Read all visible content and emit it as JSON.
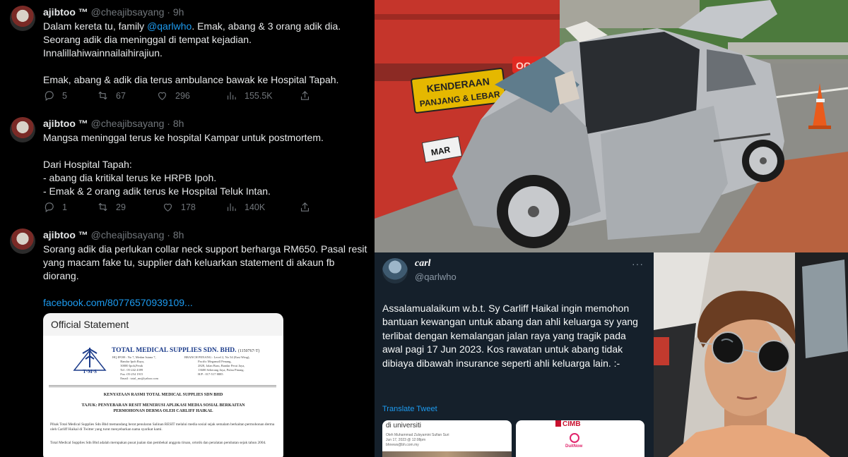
{
  "thread": {
    "tweets": [
      {
        "name": "ajibtoo ™",
        "handle": "@cheajibsayang",
        "time": "· 9h",
        "lines": {
          "l1a": "Dalam kereta tu, family ",
          "l1m": "@qarlwho",
          "l1b": ". Emak, abang & 3 orang adik dia.",
          "l2": "Seorang adik dia meninggal di tempat kejadian.",
          "l3": "Innalillahiwainnailaihirajiun.",
          "l4": "Emak, abang & adik dia terus ambulance bawak ke Hospital Tapah."
        },
        "replies": "5",
        "retweets": "67",
        "likes": "296",
        "views": "155.5K"
      },
      {
        "name": "ajibtoo ™",
        "handle": "@cheajibsayang",
        "time": "· 8h",
        "lines": {
          "l1": "Mangsa meninggal terus ke hospital Kampar untuk postmortem.",
          "l2": "Dari Hospital Tapah:",
          "l3": "- abang dia kritikal terus ke HRPB Ipoh.",
          "l4": "- Emak & 2 orang adik terus ke Hospital Teluk Intan."
        },
        "replies": "1",
        "retweets": "29",
        "likes": "178",
        "views": "140K"
      },
      {
        "name": "ajibtoo ™",
        "handle": "@cheajibsayang",
        "time": "· 8h",
        "lines": {
          "l1": "Sorang adik dia perlukan collar neck support berharga RM650. Pasal resit",
          "l2": "yang macam fake tu, supplier dah keluarkan statement di akaun fb",
          "l3": "diorang.",
          "link": "facebook.com/80776570939109..."
        }
      }
    ],
    "statement": {
      "title": "Official Statement",
      "company": "TOTAL MEDICAL SUPPLIES SDN. BHD.",
      "company_no": "(1150767-T)",
      "hq": "HQ IPOH : No 7, Medan Istana 7,\n          Bandar Ipoh Raya,\n          30000 Ipoh,Perak\n          Tel : 05-242 4399\n          Fax :05-254 1915\n          Email : total_ms@yahoo.com",
      "branch": "BRANCH PENANG : Level 2, No 54 (East Wing),\n                 Pacific Megamall Penang,\n                 2828, Jalan Baru, Bandar Perai Jaya,\n                 13600 Seberang Jaya, Pulau Pinang.\n                 H/P : 017-517 8885",
      "logo_text": "T·M·S",
      "heading1": "KENYATAAN RASMI TOTAL MEDICAL SUPPLIES SDN BHD",
      "heading2": "TAJUK: PENYEBARAN RESIT MENERUSI APLIKASI MEDIA SOSIAL BERKAITAN",
      "heading3": "PERMOHONAN DERMA OLEH CARLIFF HAIKAL",
      "para1": "Pihak Total Medical Supplies Sdn Bhd memandang berat penularan Salinan RESIT melalui media sosial sejak semalam berkaitan permohonan derma oleh Carliff Haikal di Twitter yang turut menyebarkan nama syarikat kami.",
      "para2": "Total Medical Supplies Sdn Bhd adalah merupakan pusat jualan dan pembekal anggota tiruan, ortotik dan peralatan perubatan sejak tahun 2004."
    }
  },
  "photo": {
    "sign_line1": "KENDERAAN",
    "sign_line2": "PANJANG & LEBAR",
    "plate": "MAR",
    "light_text": "OCO"
  },
  "carl": {
    "name": "carl",
    "handle": "@qarlwho",
    "more": "···",
    "text": "Assalamualaikum w.b.t. Sy Carliff Haikal ingin memohon bantuan kewangan untuk abang dan ahli keluarga sy yang terlibat dengan kemalangan jalan raya yang tragik pada awal pagi 17 Jun 2023. Kos rawatan untuk abang tidak dibiaya dibawah insurance seperti ahli keluarga lain. :-",
    "translate": "Translate Tweet",
    "attachment1": {
      "title": "di universiti",
      "meta": "Oleh Muhammad Zulsyamini Sufian Suri\nJun 17, 2023 @ 12:08pm\nbhnews@bh.com.my"
    },
    "attachment2": {
      "bank": "CIMB",
      "wallet": "DuitNow"
    }
  },
  "colors": {
    "bg": "#000000",
    "link": "#1d9bf0",
    "muted": "#71767b",
    "dim_bg": "#15202b"
  },
  "icons": [
    "reply-icon",
    "retweet-icon",
    "like-icon",
    "views-icon",
    "share-icon"
  ]
}
